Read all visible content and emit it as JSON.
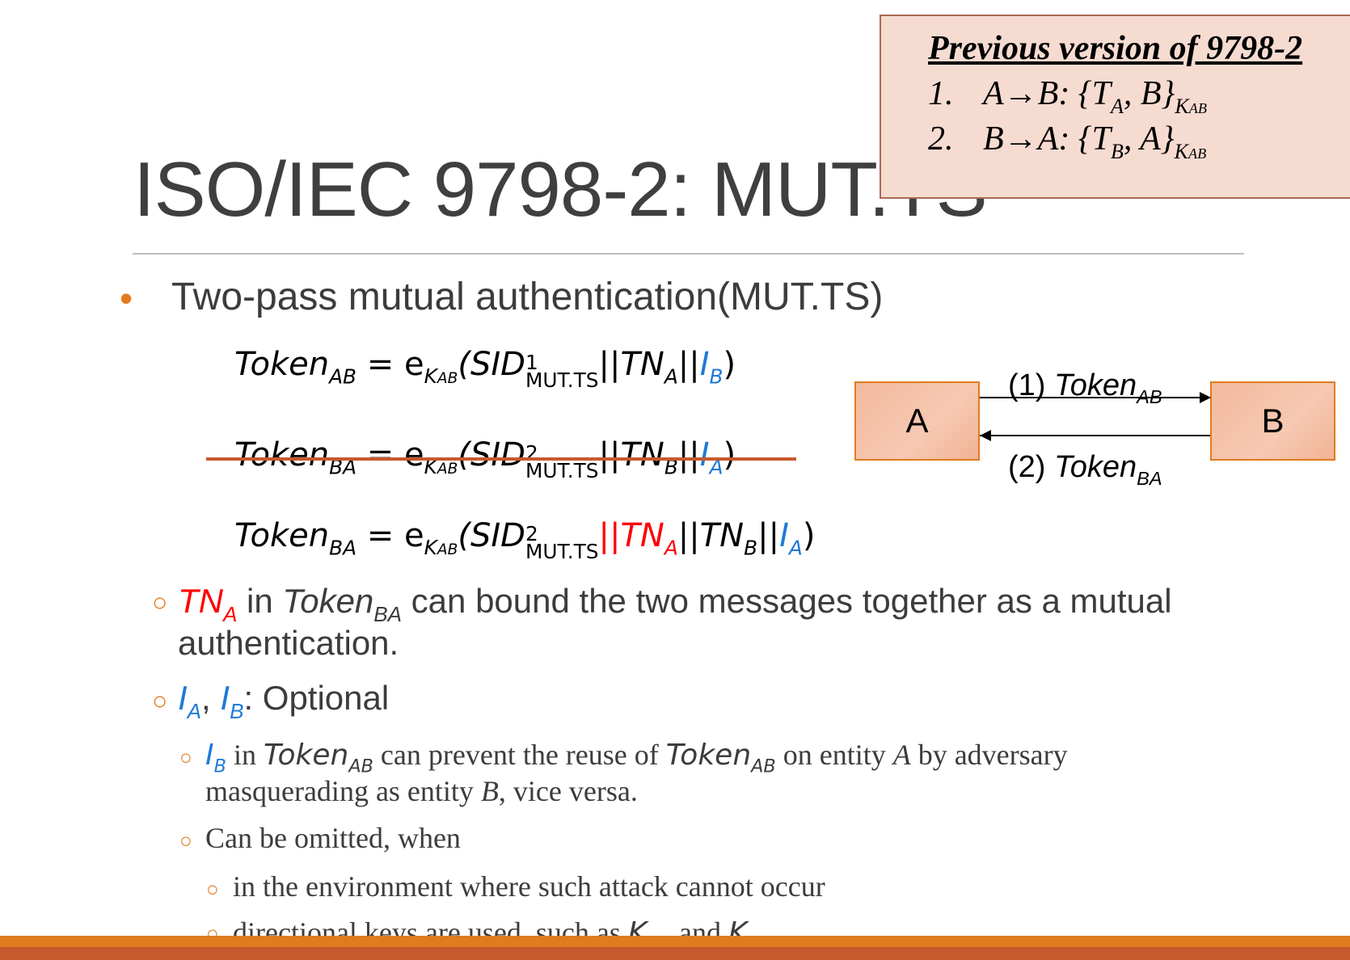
{
  "slide": {
    "title": "ISO/IEC 9798-2: MUT.TS",
    "bullet_main": "Two-pass  mutual authentication(MUT.TS)"
  },
  "previous_version": {
    "heading": "Previous version of 9798-2",
    "steps": [
      {
        "num": "1.",
        "from": "A",
        "to": "B",
        "content_open": ": {T",
        "t_sub": "A",
        "content_close": ", B}",
        "key": "K",
        "key_sub": "AB"
      },
      {
        "num": "2.",
        "from": "B",
        "to": "A",
        "content_open": ": {T",
        "t_sub": "B",
        "content_close": ", A}",
        "key": "K",
        "key_sub": "AB"
      }
    ]
  },
  "equations": {
    "token": "Token",
    "ab": "AB",
    "ba": "BA",
    "equals": " = e",
    "k": "K",
    "sid": "(SID",
    "sup1": "1",
    "sup2": "2",
    "mut_ts": "MUT.TS",
    "bars": "||",
    "tn": "TN",
    "a": "A",
    "b": "B",
    "i": "I",
    "close": ")"
  },
  "diagram": {
    "party_a": "A",
    "party_b": "B",
    "msg1_prefix": "(1) ",
    "msg2_prefix": "(2) "
  },
  "points": {
    "sub1_mid": " in ",
    "sub1_tail": "  can bound the two messages together  as a mutual authentication.",
    "sub2_sep": ", ",
    "sub2_tail": ": Optional",
    "subsub1_a": " in ",
    "subsub1_b": " can prevent the reuse of ",
    "subsub1_c": " on entity ",
    "subsub1_d": " by adversary masquerading as entity ",
    "subsub1_e": ", vice versa.",
    "subsub2": "Can be omitted, when",
    "lvl4_1": "in the environment where such attack cannot occur",
    "lvl4_2_a": "directional keys are used, such as ",
    "lvl4_2_b": " and "
  },
  "glyphs": {
    "bullet": "•",
    "circle": "○",
    "arrow": "→"
  },
  "colors": {
    "accent_orange": "#e07b1f",
    "bar_dark": "#c65a2c",
    "highlight_red": "#ff0000",
    "highlight_blue": "#1f7ad6",
    "box_fill": "#f6dbd1"
  }
}
